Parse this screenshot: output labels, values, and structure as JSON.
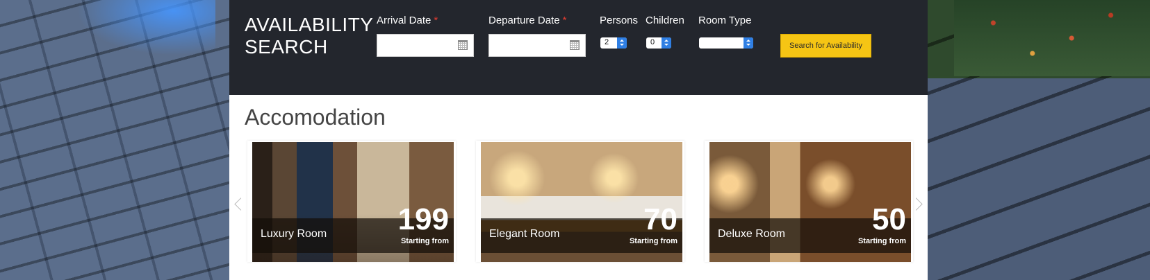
{
  "search": {
    "title_line1": "AVAILABILITY",
    "title_line2": "SEARCH",
    "arrival_label": "Arrival Date",
    "departure_label": "Departure Date",
    "required_mark": "*",
    "arrival_value": "",
    "departure_value": "",
    "persons_label": "Persons",
    "persons_value": "2",
    "children_label": "Children",
    "children_value": "0",
    "room_type_label": "Room Type",
    "room_type_value": "",
    "button_label": "Search for Availability"
  },
  "accommodation": {
    "title": "Accomodation",
    "rooms": [
      {
        "name": "Luxury Room",
        "price": "199",
        "price_note": "Starting from"
      },
      {
        "name": "Elegant Room",
        "price": "70",
        "price_note": "Starting from"
      },
      {
        "name": "Deluxe Room",
        "price": "50",
        "price_note": "Starting from"
      }
    ]
  },
  "colors": {
    "search_bar": "#23262d",
    "button": "#f6c514",
    "required": "#e03c31",
    "select_arrow": "#2f7fe4"
  },
  "icons": [
    "calendar-icon",
    "chevron-left-icon",
    "chevron-right-icon"
  ]
}
